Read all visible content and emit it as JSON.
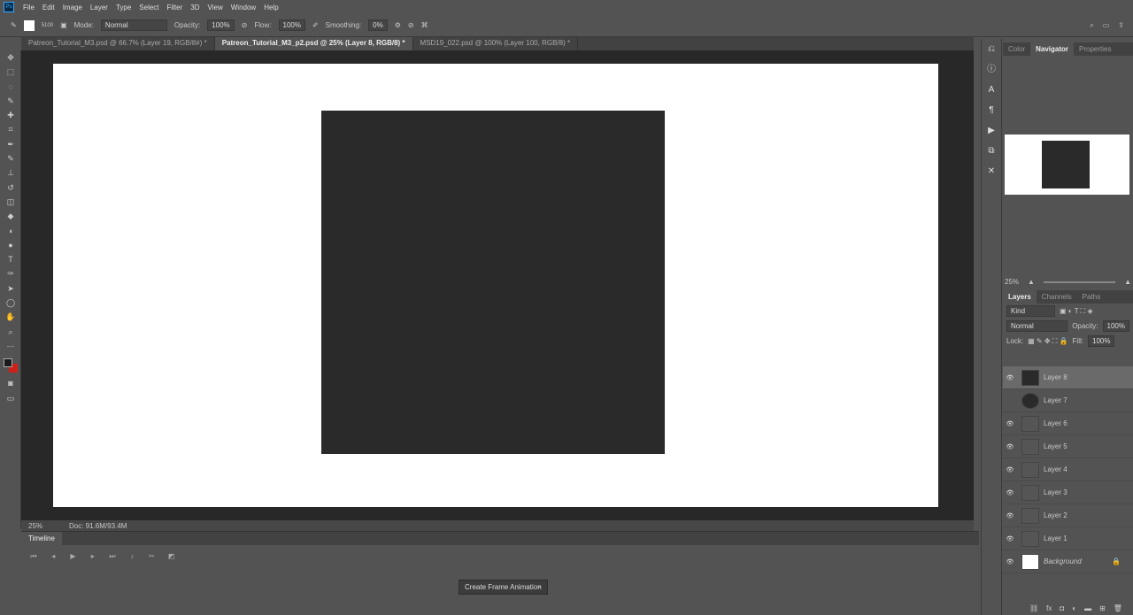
{
  "app": {
    "logo": "Ps"
  },
  "menu": [
    "File",
    "Edit",
    "Image",
    "Layer",
    "Type",
    "Select",
    "Filter",
    "3D",
    "View",
    "Window",
    "Help"
  ],
  "options": {
    "brush_size": "5100",
    "mode_label": "Mode:",
    "mode": "Normal",
    "opacity_label": "Opacity:",
    "opacity": "100%",
    "flow_label": "Flow:",
    "flow": "100%",
    "smoothing_label": "Smoothing:",
    "smoothing": "0%"
  },
  "tabs": [
    {
      "label": "Patreon_Tutorial_M3.psd @ 66.7% (Layer 19, RGB/8#) *",
      "active": false
    },
    {
      "label": "Patreon_Tutorial_M3_p2.psd @ 25% (Layer 8, RGB/8) *",
      "active": true
    },
    {
      "label": "MSD19_022.psd @ 100% (Layer 100, RGB/8) *",
      "active": false
    }
  ],
  "status": {
    "zoom": "25%",
    "doc": "Doc: 91.6M/93.4M"
  },
  "timeline": {
    "title": "Timeline",
    "create_button": "Create Frame Animation"
  },
  "navigator": {
    "tabs": [
      "Color",
      "Navigator",
      "Properties"
    ],
    "active": "Navigator",
    "zoom": "25%"
  },
  "layers_panel": {
    "tabs": [
      "Layers",
      "Channels",
      "Paths"
    ],
    "active": "Layers",
    "filter": "Kind",
    "blend": "Normal",
    "opacity_label": "Opacity:",
    "opacity": "100%",
    "lock_label": "Lock:",
    "fill_label": "Fill:",
    "fill": "100%",
    "layers": [
      {
        "name": "Layer 8",
        "selected": true,
        "visible": true
      },
      {
        "name": "Layer 7",
        "selected": false,
        "visible": false
      },
      {
        "name": "Layer 6",
        "selected": false,
        "visible": true
      },
      {
        "name": "Layer 5",
        "selected": false,
        "visible": true
      },
      {
        "name": "Layer 4",
        "selected": false,
        "visible": true
      },
      {
        "name": "Layer 3",
        "selected": false,
        "visible": true
      },
      {
        "name": "Layer 2",
        "selected": false,
        "visible": true
      },
      {
        "name": "Layer 1",
        "selected": false,
        "visible": true
      },
      {
        "name": "Background",
        "selected": false,
        "visible": true
      }
    ]
  },
  "colors": {
    "foreground": "#1a1a1a",
    "background": "#d0201a",
    "canvas_shape": "#2a2a2a"
  }
}
